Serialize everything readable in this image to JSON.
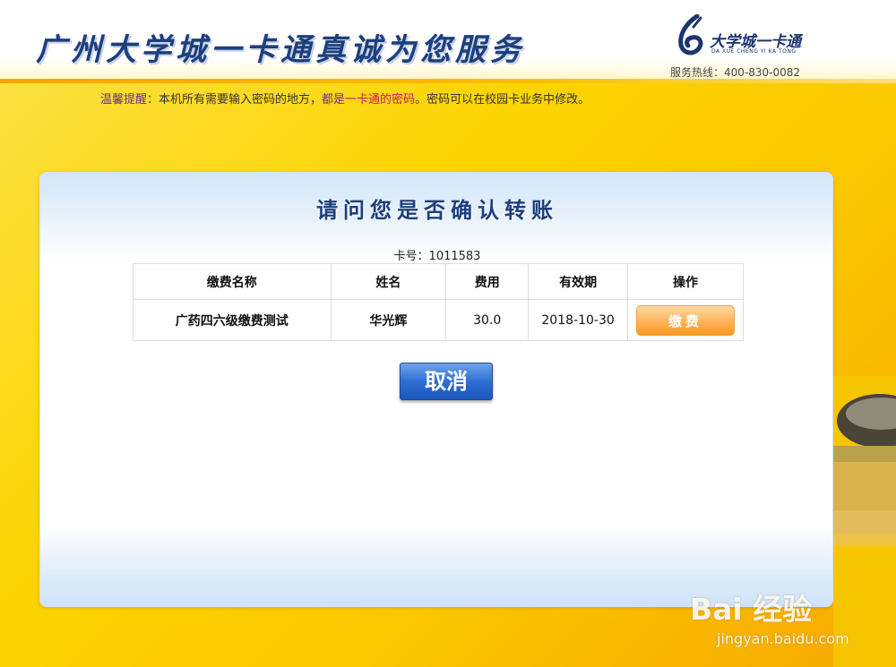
{
  "header": {
    "title": "广州大学城一卡通真诚为您服务",
    "logo_name": "大学城一卡通",
    "logo_pinyin": "DA XUE CHENG YI KA TONG",
    "hotline": "服务热线：400-830-0082"
  },
  "notice": {
    "label": "温馨提醒",
    "part1": "：本机所有需要输入密码的地方，",
    "part2": "都是",
    "highlight": "一卡通的密码",
    "part3": "。密码可以在校园卡业务中修改。"
  },
  "panel": {
    "title": "请问您是否确认转账",
    "card_label": "卡号：",
    "card_number": "1011583"
  },
  "table": {
    "headers": [
      "缴费名称",
      "姓名",
      "费用",
      "有效期",
      "操作"
    ],
    "row": {
      "item_name": "广药四六级缴费测试",
      "name": "华光辉",
      "fee": "30.0",
      "valid_until": "2018-10-30",
      "action_label": "缴费"
    }
  },
  "buttons": {
    "cancel_label": "取消"
  },
  "watermark": {
    "logo": "Bai  经验",
    "url": "jingyan.baidu.com"
  },
  "colors": {
    "title_blue": "#1c3f7e",
    "pay_orange": "#f7991f",
    "cancel_blue": "#2f6ed4",
    "notice_purple": "#6a2f8f",
    "notice_pink": "#c8166b",
    "background_yellow": "#fcd400"
  }
}
